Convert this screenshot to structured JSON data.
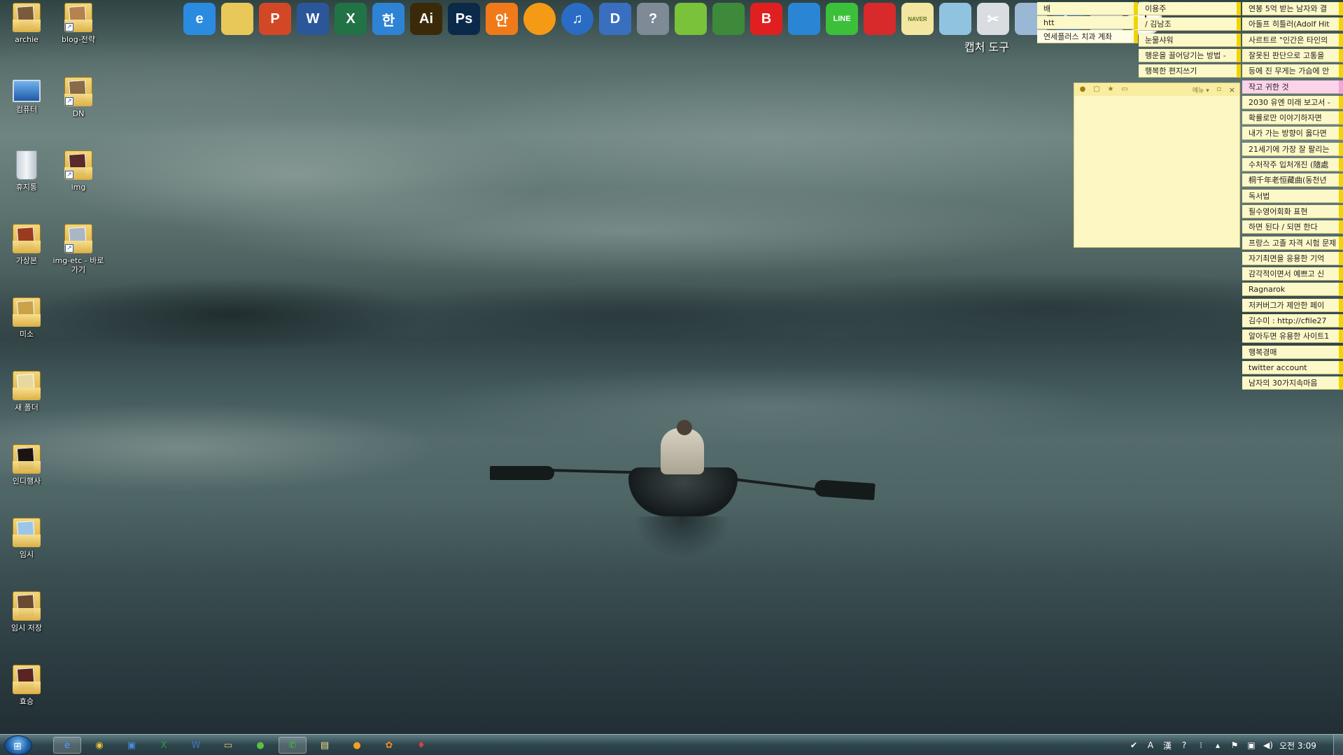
{
  "desktop_icons": [
    {
      "label": "archie",
      "type": "user-folder",
      "icon": "user-folder-icon"
    },
    {
      "label": "blog-전략",
      "type": "folder-shortcut",
      "icon": "folder-shortcut-icon"
    },
    {
      "label": "컴퓨터",
      "type": "computer",
      "icon": "computer-icon"
    },
    {
      "label": "DN",
      "type": "folder-shortcut",
      "icon": "folder-shortcut-icon"
    },
    {
      "label": "휴지통",
      "type": "trash",
      "icon": "recycle-bin-icon"
    },
    {
      "label": "img",
      "type": "folder-shortcut",
      "icon": "folder-shortcut-icon"
    },
    {
      "label": "가상본",
      "type": "folder",
      "icon": "folder-icon"
    },
    {
      "label": "img-etc - 바로 가기",
      "type": "folder-shortcut",
      "icon": "folder-shortcut-icon"
    },
    {
      "label": "미소",
      "type": "folder",
      "icon": "folder-icon"
    },
    {
      "label": "새 폴더",
      "type": "folder",
      "icon": "folder-icon"
    },
    {
      "label": "인디행사",
      "type": "folder",
      "icon": "folder-icon"
    },
    {
      "label": "임시",
      "type": "folder",
      "icon": "folder-icon"
    },
    {
      "label": "임시 저장",
      "type": "folder",
      "icon": "folder-icon"
    },
    {
      "label": "효승",
      "type": "folder",
      "icon": "folder-icon"
    }
  ],
  "app_bar": {
    "icons": [
      {
        "name": "internet-explorer-icon",
        "glyph": "e",
        "color": "#2b8be0"
      },
      {
        "name": "file-explorer-icon",
        "glyph": "",
        "color": "#e9c85a"
      },
      {
        "name": "powerpoint-icon",
        "glyph": "P",
        "color": "#d24726"
      },
      {
        "name": "word-icon",
        "glyph": "W",
        "color": "#2b579a"
      },
      {
        "name": "excel-icon",
        "glyph": "X",
        "color": "#217346"
      },
      {
        "name": "hangul-icon",
        "glyph": "한",
        "color": "#2f83d4"
      },
      {
        "name": "illustrator-icon",
        "glyph": "Ai",
        "color": "#3a2a0a"
      },
      {
        "name": "photoshop-icon",
        "glyph": "Ps",
        "color": "#0b2a4a"
      },
      {
        "name": "ahnlab-icon",
        "glyph": "안",
        "color": "#f07a1a"
      },
      {
        "name": "media-player-icon",
        "glyph": "",
        "color": "#f59a14"
      },
      {
        "name": "itunes-icon",
        "glyph": "♫",
        "color": "#2a6cc4"
      },
      {
        "name": "video-editor-icon",
        "glyph": "D",
        "color": "#3a6fc0"
      },
      {
        "name": "magnifier-icon",
        "glyph": "?",
        "color": "#7e8a95"
      },
      {
        "name": "frog-app-icon",
        "glyph": "",
        "color": "#79c23a"
      },
      {
        "name": "evernote-icon",
        "glyph": "",
        "color": "#3d8a3a"
      },
      {
        "name": "bandizip-icon",
        "glyph": "B",
        "color": "#e02020"
      },
      {
        "name": "puzzle-icon",
        "glyph": "",
        "color": "#2a86d4"
      },
      {
        "name": "line-icon",
        "glyph": "LINE",
        "color": "#3cc03a"
      },
      {
        "name": "owl-app-icon",
        "glyph": "",
        "color": "#d82a2a"
      },
      {
        "name": "naver-memo-icon",
        "glyph": "NAVER",
        "color": "#f3e6a0"
      },
      {
        "name": "eraser-icon",
        "glyph": "",
        "color": "#8fc3e0"
      },
      {
        "name": "capture-tool-icon",
        "glyph": "✂",
        "color": "#d9dde2"
      },
      {
        "name": "calculator-icon",
        "glyph": "",
        "color": "#9ab7d6"
      },
      {
        "name": "teamviewer-icon",
        "glyph": "⇆",
        "color": "#1d6fd6"
      },
      {
        "name": "sound-app-icon",
        "glyph": "",
        "color": "#b0c8de"
      }
    ],
    "capture_label": "캡처 도구"
  },
  "notes_right": [
    {
      "text": "연봉 5억 받는 남자와 결",
      "color": "yellow"
    },
    {
      "text": "아돌프 히틀러(Adolf Hit",
      "color": "yellow"
    },
    {
      "text": "사르트르 \"인간은 타인의",
      "color": "yellow"
    },
    {
      "text": "잘못된 판단으로 고통을",
      "color": "yellow"
    },
    {
      "text": "등에 진 무게는 가슴에 안",
      "color": "yellow"
    },
    {
      "text": "작고 귀한 것",
      "color": "pink"
    },
    {
      "text": "2030 유엔 미래 보고서 -",
      "color": "yellow"
    },
    {
      "text": "확률로만 이야기하자면",
      "color": "yellow"
    },
    {
      "text": "내가 가는 방향이 옳다면",
      "color": "yellow"
    },
    {
      "text": "21세기에 가장 잘 팔리는",
      "color": "yellow"
    },
    {
      "text": "수처작주 입처개진 (隨處",
      "color": "yellow"
    },
    {
      "text": "桐千年老恒藏曲(동천년",
      "color": "yellow"
    },
    {
      "text": "독서법",
      "color": "yellow"
    },
    {
      "text": "필수영어회화 표현",
      "color": "yellow"
    },
    {
      "text": "하면 된다 / 되면 한다",
      "color": "yellow"
    },
    {
      "text": "프랑스 고졸 자격 시험 문제",
      "color": "yellow"
    },
    {
      "text": "자기최면을 응용한 기억",
      "color": "yellow"
    },
    {
      "text": "감각적이면서 예쁘고 신",
      "color": "yellow"
    },
    {
      "text": "Ragnarok",
      "color": "yellow"
    },
    {
      "text": "저커버그가 제안한 페이",
      "color": "yellow"
    },
    {
      "text": "김수미 : http://cfile27",
      "color": "yellow"
    },
    {
      "text": "알아두면 유용한 사이트1",
      "color": "yellow"
    },
    {
      "text": "행복경매",
      "color": "yellow"
    },
    {
      "text": "twitter account",
      "color": "yellow"
    },
    {
      "text": "남자의 30가지속마음",
      "color": "yellow"
    }
  ],
  "notes_mid": [
    {
      "text": "이용주",
      "color": "yellow"
    },
    {
      "text": "/ 김남조",
      "color": "yellow"
    },
    {
      "text": "눈물샤워",
      "color": "yellow"
    },
    {
      "text": "행운을 끌어당기는 방법 -",
      "color": "yellow"
    },
    {
      "text": "행복한 편지쓰기",
      "color": "yellow"
    }
  ],
  "notes_left": [
    {
      "text": "배",
      "color": "yellow"
    },
    {
      "text": "htt",
      "color": "yellow"
    },
    {
      "text": "연세플러스 치과 계좌",
      "color": "white"
    }
  ],
  "sticky_panel": {
    "menu_label": "메뉴 ▾"
  },
  "taskbar": {
    "items": [
      {
        "name": "ie-taskbar",
        "glyph": "e",
        "active": true
      },
      {
        "name": "chrome-taskbar",
        "glyph": "◉",
        "active": false
      },
      {
        "name": "app-blue-taskbar",
        "glyph": "▣",
        "active": false
      },
      {
        "name": "excel-taskbar",
        "glyph": "X",
        "active": false
      },
      {
        "name": "word-taskbar",
        "glyph": "W",
        "active": false
      },
      {
        "name": "explorer-taskbar",
        "glyph": "▭",
        "active": false
      },
      {
        "name": "green-app-taskbar",
        "glyph": "●",
        "active": false
      },
      {
        "name": "kakao-taskbar",
        "glyph": "✆",
        "active": true
      },
      {
        "name": "notes-taskbar",
        "glyph": "▤",
        "active": false
      },
      {
        "name": "player-taskbar",
        "glyph": "●",
        "active": false
      },
      {
        "name": "orange-app-taskbar",
        "glyph": "✿",
        "active": false
      },
      {
        "name": "red-app-taskbar",
        "glyph": "♦",
        "active": false
      }
    ],
    "tray": {
      "ime_mode": "A",
      "hanja": "漢",
      "help": "?",
      "clock": "오전 3:09"
    }
  }
}
